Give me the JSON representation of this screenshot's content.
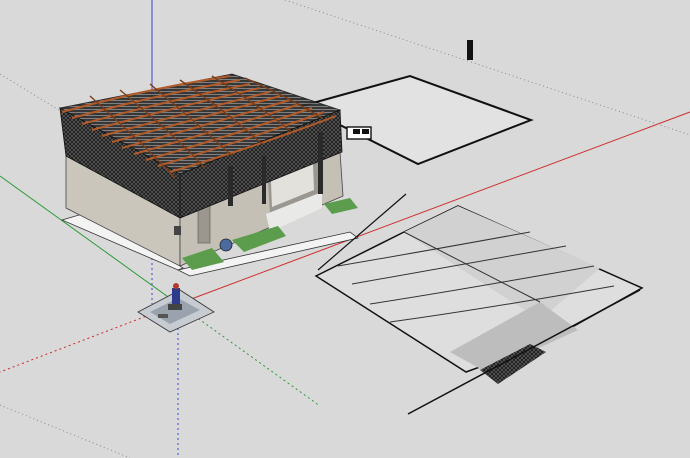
{
  "app": "SketchUp",
  "scene": {
    "sky_color": "#d9d9d9",
    "ground_color": "#d9d9d9",
    "axis_colors": {
      "red": "#cc2a2a",
      "green": "#2f9a3a",
      "blue": "#3a46d6"
    },
    "wall_color": "#cbc6bc",
    "roof_color": "#1c1c1c",
    "grass_color": "#5b9d4c",
    "slab_color": "#f3f3f3",
    "rafter_color": "#b25a28",
    "model_objects": [
      "building-with-pergola-roof",
      "rectangular-slab-outline",
      "sloped-driveway-ramp",
      "person-figure-on-mat",
      "small-post"
    ]
  }
}
